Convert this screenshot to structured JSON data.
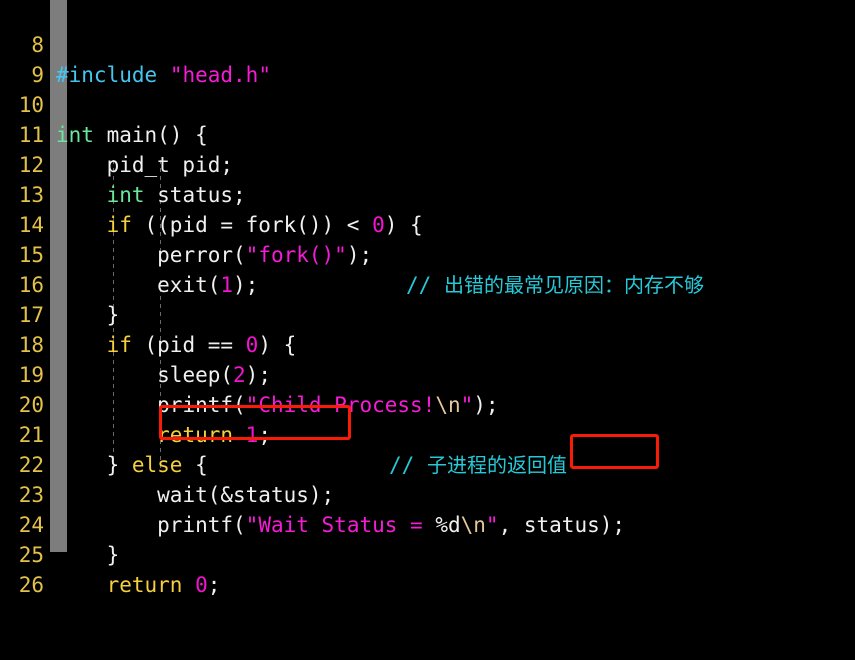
{
  "editor": {
    "background_color": "#000000",
    "gutter_color": "#7d7d7d",
    "line_number_color": "#e3c14a",
    "language": "C",
    "first_line_number": 8,
    "last_line_number": 26
  },
  "palette": {
    "preprocessor": "#45c6f0",
    "string": "#f51cd6",
    "escape": "#e6c79c",
    "keyword": "#f5d03c",
    "type": "#6ae89b",
    "number": "#f214d0",
    "plain": "#f0f0f0",
    "comment": "#27c9d8",
    "annotation": "#f81b06"
  },
  "line_numbers": {
    "n8": "8",
    "n9": "9",
    "n10": "10",
    "n11": "11",
    "n12": "12",
    "n13": "13",
    "n14": "14",
    "n15": "15",
    "n16": "16",
    "n17": "17",
    "n18": "18",
    "n19": "19",
    "n20": "20",
    "n21": "21",
    "n22": "22",
    "n23": "23",
    "n24": "24",
    "n25": "25",
    "n26": "26"
  },
  "code": {
    "l8": {
      "directive": "#include",
      "space": " ",
      "header": "\"head.h\""
    },
    "l9": {
      "text": ""
    },
    "l10": {
      "type": "int",
      "rest": " main() {"
    },
    "l11": {
      "text": "    pid_t pid;"
    },
    "l12": {
      "indent": "    ",
      "type": "int",
      "rest": " status;"
    },
    "l13": {
      "indent": "    ",
      "keyword": "if",
      "mid": " ((pid = fork()) < ",
      "number": "0",
      "tail": ") {"
    },
    "l14": {
      "indent": "        ",
      "call": "perror(",
      "string": "\"fork()\"",
      "tail": ");",
      "comment_slashes": "//",
      "comment_text": "出错的最常见原因：内存不够"
    },
    "l15": {
      "indent": "        ",
      "call": "exit(",
      "number": "1",
      "tail": ");"
    },
    "l16": {
      "text": "    }"
    },
    "l17": {
      "indent": "    ",
      "keyword": "if",
      "mid": " (pid == ",
      "number": "0",
      "tail": ") {"
    },
    "l18": {
      "indent": "        ",
      "call": "sleep(",
      "number": "2",
      "tail": ");"
    },
    "l19": {
      "indent": "        ",
      "call": "printf(",
      "string": "\"Child Process!",
      "escape": "\\n",
      "string_end": "\"",
      "tail": ");"
    },
    "l20": {
      "indent": "        ",
      "keyword": "return",
      "space": " ",
      "number": "1",
      "tail": ";",
      "comment_slashes": "//",
      "comment_text": "子进程的返回值"
    },
    "l21": {
      "text": "    } else {",
      "keyword": "else"
    },
    "l22": {
      "indent": "        ",
      "boxed": "wait(&status)",
      "tail": ";"
    },
    "l23": {
      "indent": "        ",
      "call": "printf(",
      "string": "\"Wait Status = ",
      "fmt": "%d",
      "escape": "\\n",
      "string_end": "\"",
      "comma": ", ",
      "boxed": "status",
      "tail": ");"
    },
    "l24": {
      "text": "    }"
    },
    "l25": {
      "indent": "    ",
      "keyword": "return",
      "space": " ",
      "number": "0",
      "tail": ";"
    },
    "l26": {
      "text": ""
    }
  },
  "annotations": {
    "box1": {
      "target": "wait(&status)",
      "line": "22",
      "color": "#f81b06"
    },
    "box2": {
      "target": "status",
      "line": "23",
      "color": "#f81b06"
    }
  }
}
